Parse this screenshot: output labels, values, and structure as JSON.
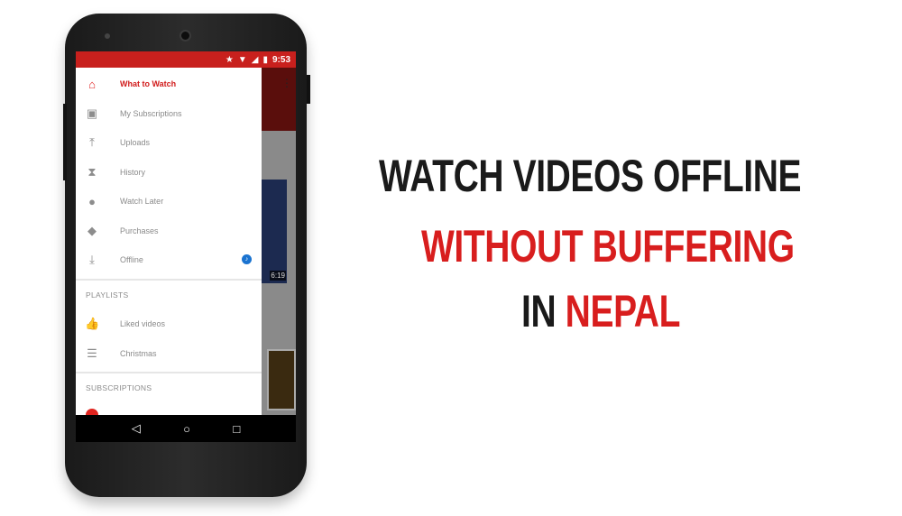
{
  "status_bar": {
    "time": "9:53",
    "icons": [
      "star-icon",
      "wifi-icon",
      "signal-icon",
      "battery-icon"
    ]
  },
  "drawer": {
    "items": [
      {
        "label": "What to Watch",
        "icon": "home-icon",
        "active": true
      },
      {
        "label": "My Subscriptions",
        "icon": "subscriptions-icon"
      },
      {
        "label": "Uploads",
        "icon": "upload-icon"
      },
      {
        "label": "History",
        "icon": "hourglass-icon"
      },
      {
        "label": "Watch Later",
        "icon": "clock-icon"
      },
      {
        "label": "Purchases",
        "icon": "tag-icon"
      },
      {
        "label": "Offline",
        "icon": "download-icon"
      }
    ],
    "playlists_header": "PLAYLISTS",
    "playlists": [
      {
        "label": "Liked videos",
        "icon": "thumbs-up-icon"
      },
      {
        "label": "Christmas",
        "icon": "playlist-icon"
      }
    ],
    "subscriptions_header": "SUBSCRIPTIONS"
  },
  "background": {
    "video_duration": "6:19"
  },
  "headline": {
    "line1": "WATCH VIDEOS OFFLINE",
    "line2": "WITHOUT BUFFERING",
    "line3_a": "IN ",
    "line3_b": "NEPAL"
  },
  "colors": {
    "accent": "#d81e1e",
    "text": "#1a1a1a"
  }
}
